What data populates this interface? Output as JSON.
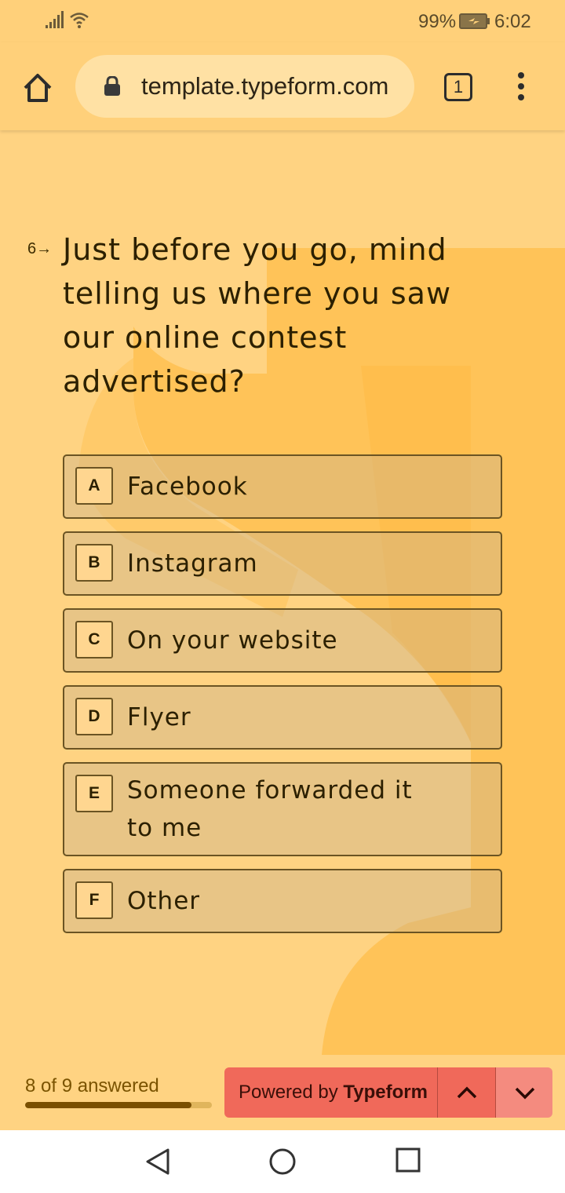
{
  "status_bar": {
    "battery_percent": "99%",
    "time": "6:02"
  },
  "browser": {
    "url": "template.typeform.com",
    "tab_count": "1"
  },
  "question": {
    "number": "6→",
    "text": "Just before you go, mind telling us where you saw our online contest advertised?"
  },
  "options": [
    {
      "key": "A",
      "label": "Facebook"
    },
    {
      "key": "B",
      "label": "Instagram"
    },
    {
      "key": "C",
      "label": "On your website"
    },
    {
      "key": "D",
      "label": "Flyer"
    },
    {
      "key": "E",
      "label": "Someone forwarded it to me"
    },
    {
      "key": "F",
      "label": "Other"
    }
  ],
  "footer": {
    "progress_text": "8 of 9 answered",
    "progress_fraction": 0.89,
    "powered_by_prefix": "Powered by ",
    "powered_by_brand": "Typeform"
  },
  "colors": {
    "background": "#ffd382",
    "accent": "#f0695a",
    "progress_fill": "#7a4f00"
  }
}
